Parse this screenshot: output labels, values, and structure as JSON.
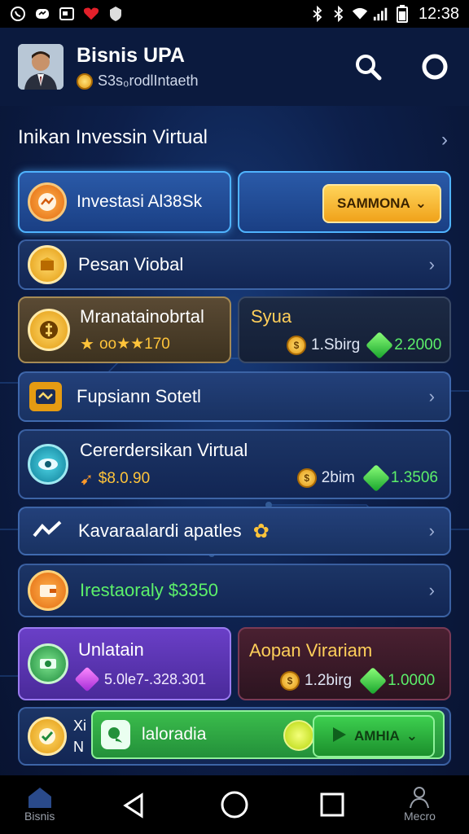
{
  "status_bar": {
    "time": "12:38",
    "left_icons": [
      "whatsapp-icon",
      "messenger-icon",
      "news-icon",
      "heart-icon",
      "shield-icon"
    ],
    "right_icons": [
      "bluetooth-icon",
      "bluetooth-icon",
      "wifi-icon",
      "signal-icon",
      "battery-icon"
    ]
  },
  "header": {
    "title": "Bisnis UPA",
    "subtitle": "S3s₀rodlIntaeth"
  },
  "section": {
    "title": "Inikan Invessin Virtual"
  },
  "cards": {
    "investasi": {
      "label": "Investasi Al38Sk",
      "button": "SAMMONA"
    },
    "pesan": {
      "label": "Pesan Viobal"
    },
    "mranata": {
      "label": "Mranatainobrtal",
      "value": "oo★★170"
    },
    "syua": {
      "label": "Syua",
      "coin_value": "1.Sbirg",
      "gem_value": "2.2000"
    },
    "fupsiann": {
      "label": "Fupsiann Sotetl"
    },
    "cererdersikan": {
      "label": "Cererdersikan Virtual",
      "value": "$8.0.90",
      "coin_value": "2bim",
      "gem_value": "1.3506"
    },
    "kavara": {
      "label": "Kavaraalardi apatles"
    },
    "irestaoraly": {
      "label": "Irestaoraly $3350"
    },
    "unlatain": {
      "label": "Unlatain",
      "value": "5.0le7-.328.301"
    },
    "adpan": {
      "label": "Aopan Virariam",
      "coin_value": "1.2birg",
      "gem_value": "1.0000"
    },
    "laloradia": {
      "label": "laloradia",
      "side_label_1": "Xi",
      "side_label_2": "N",
      "button": "AMHIA"
    }
  },
  "nav": {
    "left_label": "Bisnis",
    "right_label": "Mecro"
  },
  "colors": {
    "accent_gold": "#f0a21a",
    "accent_green": "#3dcf4f",
    "bg_dark": "#0b1a3e"
  }
}
